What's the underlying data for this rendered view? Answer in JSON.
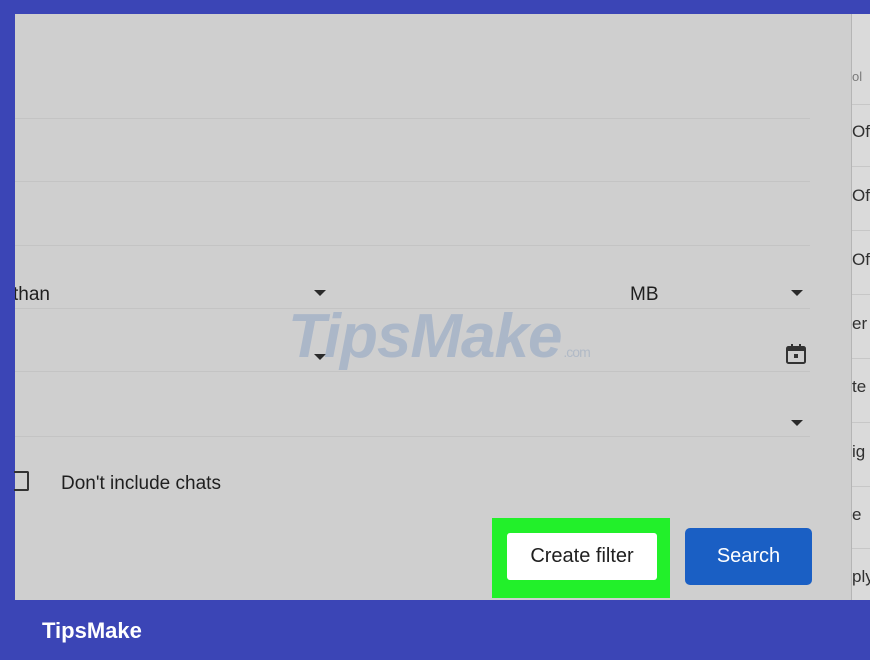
{
  "size_row": {
    "comparator_text": "than",
    "unit": "MB"
  },
  "options": {
    "dont_include_chats": "Don't include chats",
    "checked": false
  },
  "buttons": {
    "create_filter": "Create filter",
    "search": "Search"
  },
  "highlight_color": "#22f02a",
  "right_strip": {
    "fragments": [
      "ol",
      "Of",
      "Of",
      "Of",
      "er",
      "te",
      "ig",
      "e",
      "ply"
    ]
  },
  "watermark": {
    "text": "TipsMake",
    "suffix": ".com"
  },
  "footer": {
    "brand": "TipsMake"
  },
  "colors": {
    "frame": "#3b45b6",
    "panel": "#cfcfcf",
    "search_button": "#1a5fc4"
  }
}
